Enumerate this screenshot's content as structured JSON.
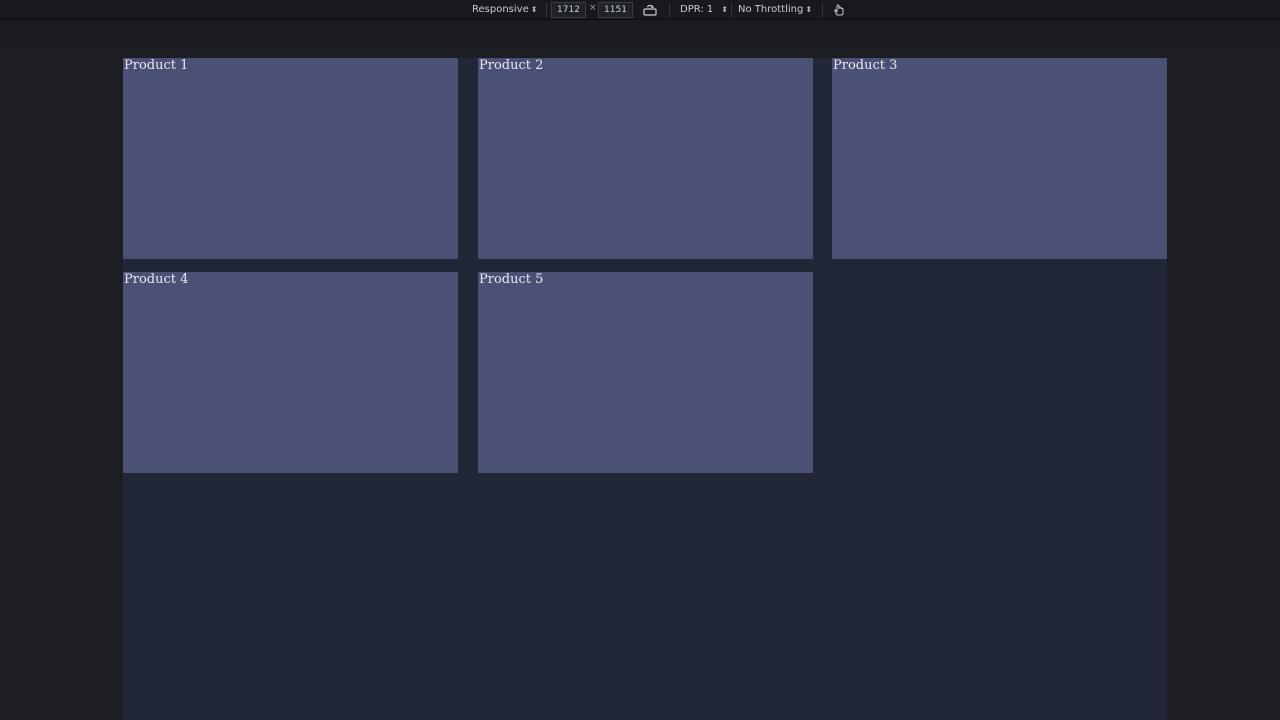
{
  "devtools_toolbar": {
    "device_mode": "Responsive",
    "width_value": "1712",
    "height_value": "1151",
    "separator": "×",
    "dpr_label": "DPR: 1",
    "throttling_label": "No Throttling",
    "rotate_icon": "rotate-viewport-icon",
    "touch_icon": "touch-simulation-icon"
  },
  "products": [
    {
      "title": "Product 1"
    },
    {
      "title": "Product 2"
    },
    {
      "title": "Product 3"
    },
    {
      "title": "Product 4"
    },
    {
      "title": "Product 5"
    }
  ],
  "colors": {
    "toolbar_bg": "#17191c",
    "page_bg": "#222738",
    "card_bg": "#4b5175",
    "card_text": "#e7e8ef"
  }
}
